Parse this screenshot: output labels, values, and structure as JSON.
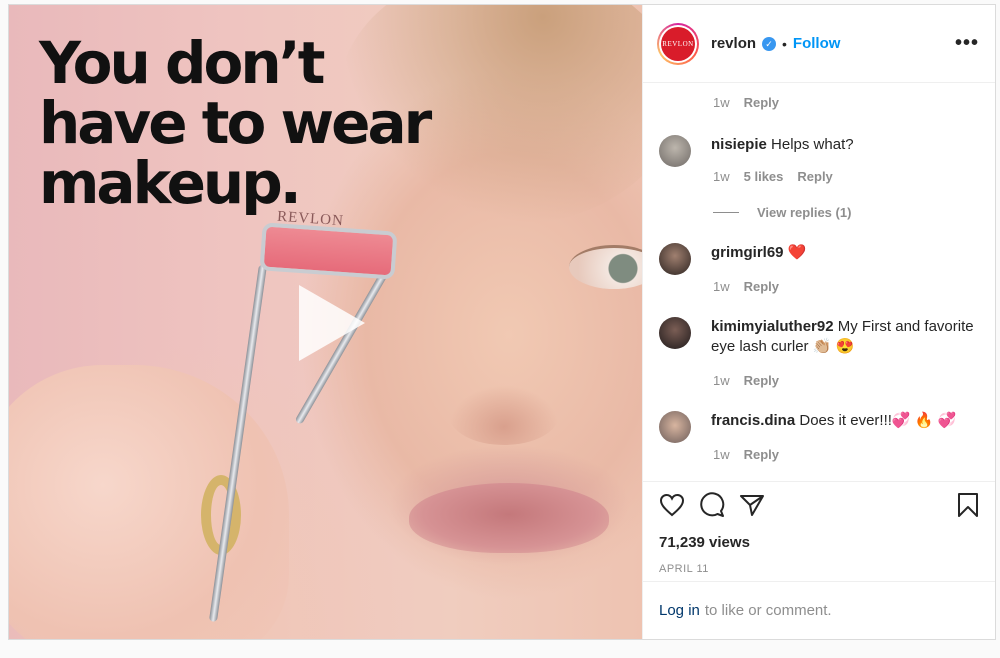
{
  "media": {
    "headline": "You don’t have to wear makeup.",
    "product_brand": "REVLON"
  },
  "header": {
    "avatar_text": "REVLON",
    "username": "revlon",
    "dot": "•",
    "follow": "Follow",
    "more": "•••"
  },
  "comments": {
    "top_meta": {
      "time": "1w",
      "reply": "Reply"
    },
    "items": [
      {
        "user": "nisiepie",
        "text": "Helps what?",
        "time": "1w",
        "likes": "5 likes",
        "reply": "Reply",
        "view_replies": "View replies (1)"
      },
      {
        "user": "grimgirl69",
        "text": "❤️",
        "time": "1w",
        "reply": "Reply"
      },
      {
        "user": "kimimyialuther92",
        "text": "My First and favorite eye lash curler 👏🏼 😍",
        "time": "1w",
        "reply": "Reply"
      },
      {
        "user": "francis.dina",
        "text": "Does it ever!!!💞 🔥 💞",
        "time": "1w",
        "reply": "Reply"
      }
    ]
  },
  "actions": {
    "views": "71,239 views",
    "date": "APRIL 11"
  },
  "login": {
    "link": "Log in",
    "rest": "to like or comment."
  },
  "colors": {
    "accent": "#0095f6",
    "brand_red": "#d91c2a",
    "text": "#262626",
    "muted": "#8e8e8e"
  },
  "icons": [
    "heart-icon",
    "comment-icon",
    "share-icon",
    "bookmark-icon",
    "verified-icon",
    "play-icon",
    "more-icon"
  ]
}
